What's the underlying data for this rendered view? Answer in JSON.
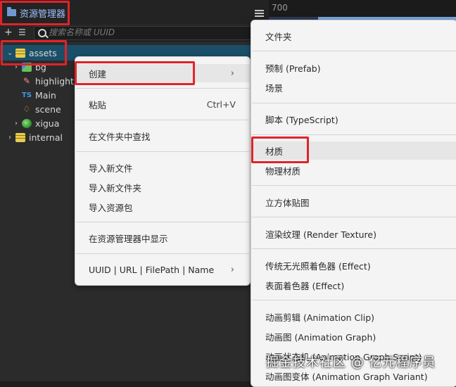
{
  "panel": {
    "title": "资源管理器",
    "search_placeholder": "搜索名称或 UUID",
    "tree": [
      {
        "label": "assets",
        "icon": "database-icon",
        "expanded": true,
        "selected": true
      },
      {
        "label": "bg",
        "icon": "image-icon"
      },
      {
        "label": "highlight",
        "icon": "highlight-icon"
      },
      {
        "label": "Main",
        "icon": "typescript-icon"
      },
      {
        "label": "scene",
        "icon": "scene-icon"
      },
      {
        "label": "xigua",
        "icon": "watermelon-icon"
      },
      {
        "label": "internal",
        "icon": "database-icon"
      }
    ]
  },
  "ruler": {
    "value": "700"
  },
  "context_menu": {
    "items": [
      {
        "label": "创建",
        "submenu": true
      },
      {
        "label": "粘贴",
        "shortcut": "Ctrl+V"
      },
      {
        "label": "在文件夹中查找"
      },
      {
        "label": "导入新文件"
      },
      {
        "label": "导入新文件夹"
      },
      {
        "label": "导入资源包"
      },
      {
        "label": "在资源管理器中显示"
      },
      {
        "label": "UUID | URL | FilePath | Name",
        "submenu": true
      }
    ]
  },
  "create_submenu": {
    "items": [
      {
        "label": "文件夹"
      },
      {
        "label": "预制 (Prefab)"
      },
      {
        "label": "场景"
      },
      {
        "label": "脚本 (TypeScript)"
      },
      {
        "label": "材质"
      },
      {
        "label": "物理材质"
      },
      {
        "label": "立方体贴图"
      },
      {
        "label": "渲染纹理 (Render Texture)"
      },
      {
        "label": "传统无光照着色器 (Effect)"
      },
      {
        "label": "表面着色器 (Effect)"
      },
      {
        "label": "动画剪辑 (Animation Clip)"
      },
      {
        "label": "动画图 (Animation Graph)"
      },
      {
        "label": "动画状态机 (Animation Graph Script)"
      },
      {
        "label": "动画图变体 (Animation Graph Variant)"
      }
    ]
  },
  "watermark": "掘金技术社区 @ 亿元程序员",
  "colors": {
    "highlight_box": "#e0242a",
    "selected_row": "#1b4f69",
    "tab_text": "#9fc1ff"
  }
}
